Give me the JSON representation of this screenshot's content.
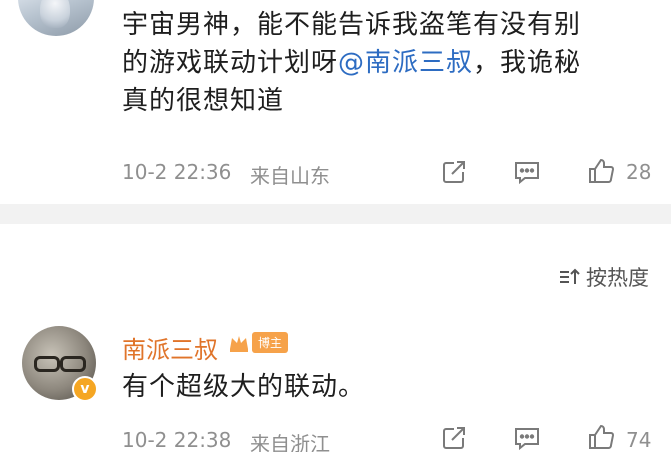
{
  "post": {
    "text_line1": "宇宙男神，能不能告诉我盗笔有没有别",
    "text_line2_pre": "的游戏联动计划呀",
    "mention": "@南派三叔",
    "text_line2_post": "，我诡秘",
    "text_line3": "真的很想知道",
    "time": "10-2 22:36",
    "location": "来自山东",
    "like_count": "28"
  },
  "sort": {
    "label": "按热度"
  },
  "reply": {
    "author": "南派三叔",
    "badge": "博主",
    "text": "有个超级大的联动。",
    "time": "10-2 22:38",
    "location": "来自浙江",
    "like_count": "74"
  },
  "icons": [
    "share-icon",
    "comment-icon",
    "like-icon",
    "sort-icon",
    "crown-icon",
    "verified-icon"
  ],
  "colors": {
    "mention": "#2d6cc2",
    "author": "#e0742a",
    "badge": "#f6a24a",
    "verified": "#f5a623",
    "divider": "#f2f2f2"
  }
}
